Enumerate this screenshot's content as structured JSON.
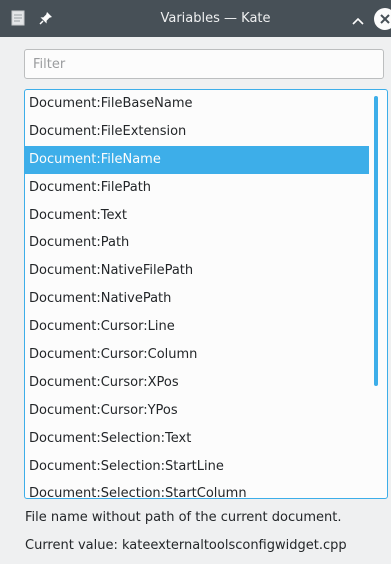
{
  "window": {
    "title": "Variables — Kate",
    "icons": {
      "document": "document-icon",
      "pin": "pin-icon",
      "minimize": "chevron-up-icon",
      "close": "close-icon"
    }
  },
  "filter": {
    "placeholder": "Filter",
    "value": ""
  },
  "variables": {
    "items": [
      "Document:FileBaseName",
      "Document:FileExtension",
      "Document:FileName",
      "Document:FilePath",
      "Document:Text",
      "Document:Path",
      "Document:NativeFilePath",
      "Document:NativePath",
      "Document:Cursor:Line",
      "Document:Cursor:Column",
      "Document:Cursor:XPos",
      "Document:Cursor:YPos",
      "Document:Selection:Text",
      "Document:Selection:StartLine",
      "Document:Selection:StartColumn"
    ],
    "selected_index": 2
  },
  "details": {
    "description": "File name without path of the current document.",
    "current_value": "Current value: kateexternaltoolsconfigwidget.cpp"
  },
  "colors": {
    "accent": "#3daee9",
    "titlebar": "#475057",
    "window_bg": "#eff0f1"
  }
}
